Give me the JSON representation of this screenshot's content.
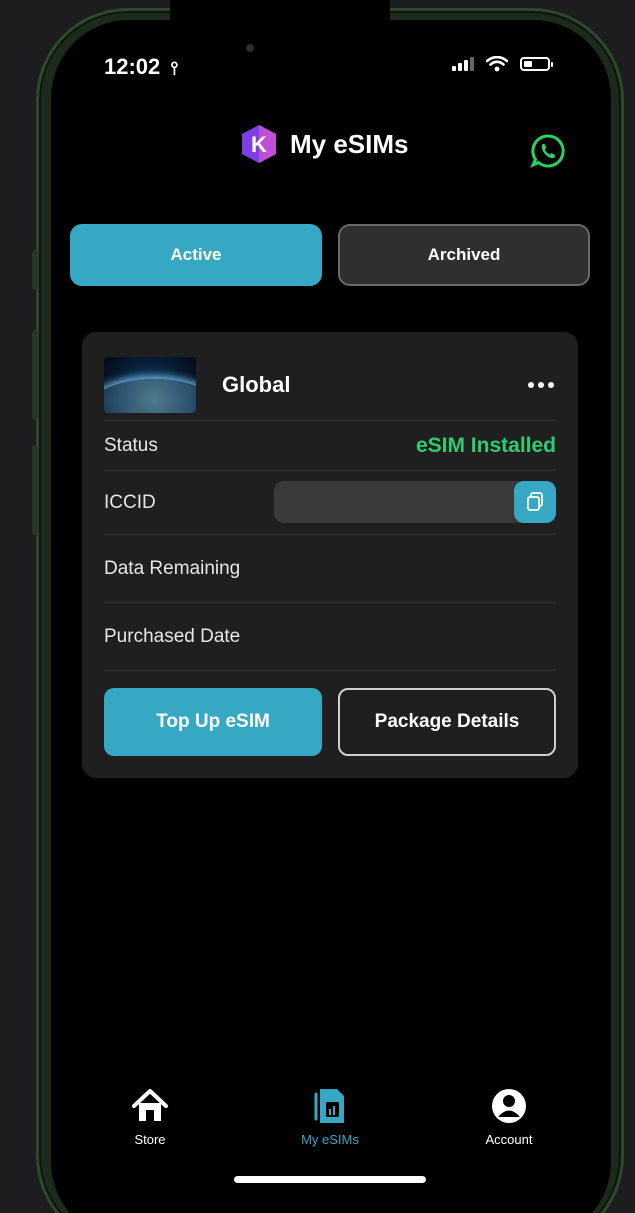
{
  "status_bar": {
    "time": "12:02"
  },
  "header": {
    "title": "My eSIMs",
    "logo_letter": "K",
    "support_icon": "whatsapp-icon"
  },
  "tabs": [
    {
      "label": "Active",
      "selected": true
    },
    {
      "label": "Archived",
      "selected": false
    }
  ],
  "esim_card": {
    "name": "Global",
    "rows": [
      {
        "label": "Status",
        "value": "eSIM Installed"
      },
      {
        "label": "ICCID",
        "value": ""
      },
      {
        "label": "Data Remaining",
        "value": ""
      },
      {
        "label": "Purchased Date",
        "value": ""
      }
    ],
    "primary_button": "Top Up eSIM",
    "secondary_button": "Package Details"
  },
  "bottom_nav": [
    {
      "label": "Store",
      "icon": "home-icon",
      "active": false
    },
    {
      "label": "My eSIMs",
      "icon": "sim-card-icon",
      "active": true
    },
    {
      "label": "Account",
      "icon": "account-icon",
      "active": false
    }
  ],
  "colors": {
    "accent": "#36a8c3",
    "status_ok": "#2ecc71",
    "whatsapp": "#25d366"
  }
}
